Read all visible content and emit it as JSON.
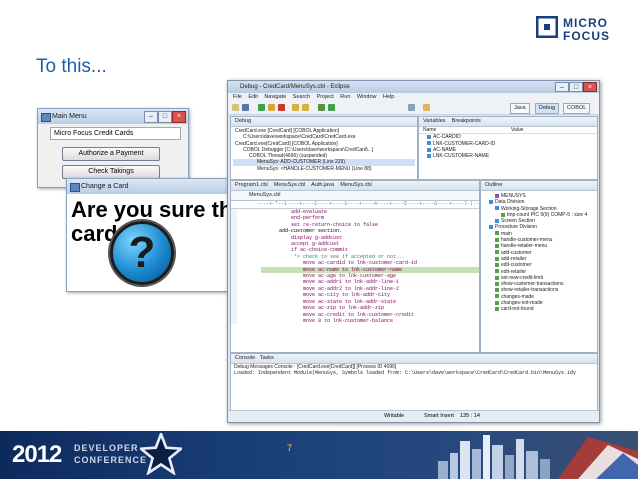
{
  "slide": {
    "title": "To this...",
    "page_number": "7"
  },
  "logo": {
    "line1": "MICRO",
    "line2": "FOCUS"
  },
  "main_menu": {
    "title": "Main Menu",
    "field_value": "Micro Focus Credit Cards",
    "buttons": [
      "Authorize a Payment",
      "Check Takings"
    ]
  },
  "charge_dialog": {
    "title": "Change a Card",
    "message": "Are you sure that's a r",
    "message_line2": "card"
  },
  "eclipse": {
    "title": "Debug - CredCard/MenuSys.cbl - Eclipse",
    "menu": [
      "File",
      "Edit",
      "Navigate",
      "Search",
      "Project",
      "Run",
      "Window",
      "Help"
    ],
    "perspectives": [
      "Java",
      "Debug",
      "COBOL"
    ],
    "debug_tab": "Debug",
    "debug_items": [
      "CredCard.exe [CredCard] [COBOL Application]",
      "C:\\Users\\dave\\workspace\\CredCard\\CredCard.exe",
      "CredCard.exe[CredCard] [COBOL Application]",
      "COBOL Debugger [C:\\Users\\dave\\workspace\\CredCard\\...]",
      "COBOL Thread(4696) (suspended)",
      "MenuSys: ADD-CUSTOMER (Line 229)",
      "MenuSys: <HANDLE-CUSTOMER-MENU (Line 88)"
    ],
    "variables_tab": "Variables",
    "breakpoints_tab": "Breakpoints",
    "variables_headers": [
      "Name",
      "Value"
    ],
    "variables": [
      "AC-CARDID",
      "LNK-CUSTOMER-CARD-ID",
      "AC-NAME",
      "LNK-CUSTOMER-NAME"
    ],
    "editor_tabs": [
      "Program1.cbl",
      "MenuSys.cbl",
      "Auth.java",
      "MenuSys.cbl"
    ],
    "editor_subtab": "MenuSys.cbl",
    "code_lines": [
      "          add-evaluate",
      "",
      "          end-perform",
      "          set re-return-choice to false",
      "",
      "",
      "      add-customer section.",
      "",
      "          display g-addcust",
      "          accept g-addcust",
      "",
      "          if ac-choice-commit",
      "           *> check to see if accepted or not...",
      "              move ac-cardid to lnk-customer-card-id",
      "              move ac-name to lnk-customer-name",
      "              move ac-age to lnk-customer-age",
      "              move ac-addr1 to lnk-addr-line-1",
      "              move ac-addr2 to lnk-addr-line-2",
      "              move ac-city to lnk-addr-city",
      "              move ac-state to lnk-addr-state",
      "              move ac-zip to lnk-addr-zip",
      "              move ac-credit to lnk-customer-credit",
      "              move 0 to lnk-customer-balance"
    ],
    "outline_tab": "Outline",
    "outline_items": [
      "MENUSYS",
      "Data Division",
      "Working-Storage Section",
      "tmp-count PIC 9(9) COMP-5 : size 4",
      "Screen Section",
      "Procedure Division",
      "main",
      "handle-customer-menu",
      "handle-retailer-menu",
      "add-customer",
      "add-retailer",
      "edit-customer",
      "edit-retailer",
      "set-new-credit-limit",
      "show-customer-transactions",
      "show-retailer-transactions",
      "changes-made",
      "changes-not-made",
      "card-not-found"
    ],
    "console_tabs": [
      "Console",
      "Tasks"
    ],
    "console_title": "Debug Messages Console : [CredCard.exe[CredCard]] [Process ID 4096]",
    "console_text": "Loaded: Independent Module(MenuSys, Symbols loaded from: C:\\Users\\dave\\workspace\\CredCard\\CredCard.bin\\MenuSys.idy",
    "status": [
      "Writable",
      "Smart Insert",
      "135 : 14"
    ]
  },
  "banner": {
    "year": "2012",
    "line1": "DEVELOPER",
    "line2": "CONFERENCE"
  }
}
